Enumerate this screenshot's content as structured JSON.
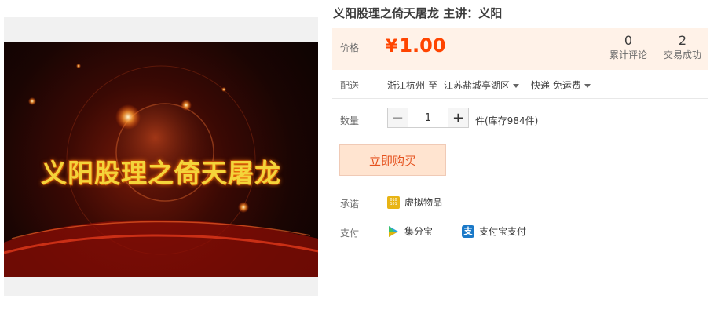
{
  "product": {
    "title": "义阳股理之倚天屠龙 主讲：义阳",
    "image_text": "义阳股理之倚天屠龙"
  },
  "price": {
    "label": "价格",
    "currency": "¥",
    "amount": "1.00"
  },
  "stats": {
    "reviews_count": "0",
    "reviews_label": "累计评论",
    "deals_count": "2",
    "deals_label": "交易成功"
  },
  "shipping": {
    "label": "配送",
    "from": "浙江杭州",
    "to_word": "至",
    "destination": "江苏盐城亭湖区",
    "method": "快递 免运费"
  },
  "quantity": {
    "label": "数量",
    "value": "1",
    "minus": "−",
    "plus": "+",
    "stock_text": "件(库存984件)"
  },
  "buy_button": "立即购买",
  "promise": {
    "label": "承诺",
    "item": "虚拟物品"
  },
  "payment": {
    "label": "支付",
    "methods": [
      "集分宝",
      "支付宝支付"
    ]
  },
  "colors": {
    "price": "#ff4400",
    "price_bg": "#fff2e8",
    "buy_bg": "#ffe4d0",
    "buy_text": "#e5511d"
  },
  "icons": {
    "virtual": "virtual-goods-icon",
    "jifen": "jifenbao-icon",
    "alipay": "alipay-icon"
  }
}
